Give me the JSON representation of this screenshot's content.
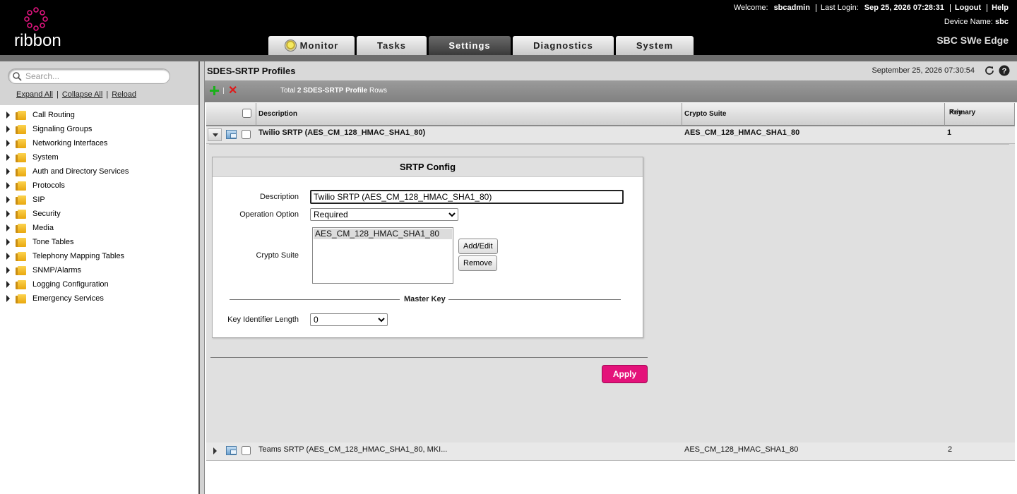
{
  "header": {
    "logo_text": "ribbon",
    "welcome_label": "Welcome:",
    "username": "sbcadmin",
    "last_login_label": "Last Login:",
    "last_login": "Sep 25, 2026 07:28:31",
    "logout": "Logout",
    "help": "Help",
    "device_label": "Device Name:",
    "device_name": "sbc",
    "product": "SBC SWe Edge"
  },
  "tabs": [
    {
      "label": "Monitor",
      "active": false
    },
    {
      "label": "Tasks",
      "active": false
    },
    {
      "label": "Settings",
      "active": true
    },
    {
      "label": "Diagnostics",
      "active": false
    },
    {
      "label": "System",
      "active": false
    }
  ],
  "sidebar": {
    "search_placeholder": "Search...",
    "expand_all": "Expand All",
    "collapse_all": "Collapse All",
    "reload": "Reload",
    "items": [
      "Call Routing",
      "Signaling Groups",
      "Networking Interfaces",
      "System",
      "Auth and Directory Services",
      "Protocols",
      "SIP",
      "Security",
      "Media",
      "Tone Tables",
      "Telephony Mapping Tables",
      "SNMP/Alarms",
      "Logging Configuration",
      "Emergency Services"
    ]
  },
  "panel": {
    "title": "SDES-SRTP Profiles",
    "date": "September 25, 2026 07:30:54",
    "total_prefix": "Total",
    "total_bold": "2 SDES-SRTP Profile",
    "total_suffix": "Rows"
  },
  "table": {
    "headers": {
      "description": "Description",
      "crypto_suite": "Crypto Suite",
      "primary_key_1": "Primary",
      "primary_key_2": "Key"
    },
    "rows": [
      {
        "description": "Twilio SRTP (AES_CM_128_HMAC_SHA1_80)",
        "crypto_suite": "AES_CM_128_HMAC_SHA1_80",
        "primary_key": "1"
      },
      {
        "description": "Teams SRTP (AES_CM_128_HMAC_SHA1_80, MKI...",
        "crypto_suite": "AES_CM_128_HMAC_SHA1_80",
        "primary_key": "2"
      }
    ]
  },
  "form": {
    "title": "SRTP Config",
    "description_label": "Description",
    "description_value": "Twilio SRTP (AES_CM_128_HMAC_SHA1_80)",
    "operation_label": "Operation Option",
    "operation_value": "Required",
    "crypto_label": "Crypto Suite",
    "crypto_items": [
      "AES_CM_128_HMAC_SHA1_80"
    ],
    "add_edit": "Add/Edit",
    "remove": "Remove",
    "master_key": "Master Key",
    "key_id_label": "Key Identifier Length",
    "key_id_value": "0",
    "apply": "Apply"
  },
  "icons": {
    "refresh": "refresh-icon",
    "help": "help-icon",
    "add": "plus-icon",
    "delete": "x-icon",
    "folder": "folder-icon"
  },
  "colors": {
    "apply_button": "#e4127a",
    "add_icon": "#19b119",
    "delete_icon": "#e01a1a",
    "header_bg": "#000000"
  }
}
